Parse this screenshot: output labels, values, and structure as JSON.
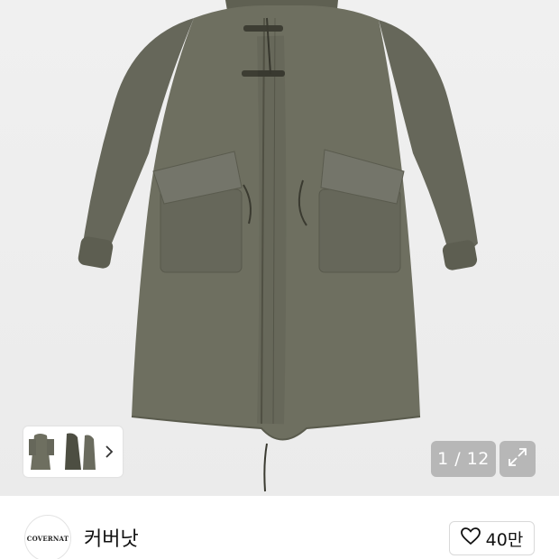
{
  "gallery": {
    "counter": "1 / 12",
    "thumbnails": [
      "front",
      "side",
      "back"
    ]
  },
  "brand": {
    "logo_text": "COVERNAT",
    "name": "커버낫"
  },
  "like": {
    "count": "40만"
  },
  "colors": {
    "jacket": "#6e6f60",
    "background": "#eeeeee",
    "overlay": "#8c8c8c"
  },
  "icons": [
    "chevron-right-icon",
    "expand-icon",
    "heart-icon"
  ]
}
